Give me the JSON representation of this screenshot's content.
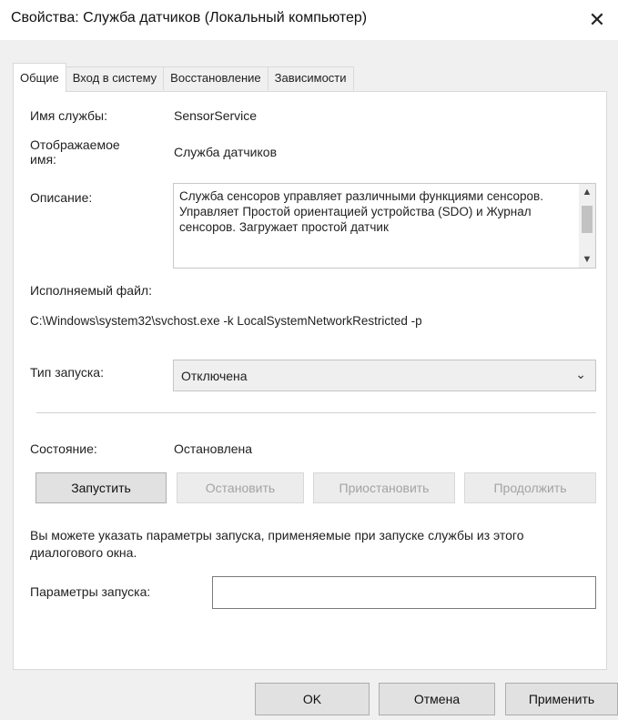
{
  "window": {
    "title": "Свойства: Служба датчиков (Локальный компьютер)",
    "close_glyph": "✕"
  },
  "tabs": [
    {
      "label": "Общие",
      "active": true
    },
    {
      "label": "Вход в систему",
      "active": false
    },
    {
      "label": "Восстановление",
      "active": false
    },
    {
      "label": "Зависимости",
      "active": false
    }
  ],
  "general": {
    "service_name_label": "Имя службы:",
    "service_name_value": "SensorService",
    "display_name_label_1": "Отображаемое",
    "display_name_label_2": "имя:",
    "display_name_value": "Служба датчиков",
    "description_label": "Описание:",
    "description_text": "Служба сенсоров управляет различными функциями сенсоров. Управляет Простой ориентацией устройства (SDO) и Журнал сенсоров. Загружает простой датчик",
    "executable_label": "Исполняемый файл:",
    "executable_path": "C:\\Windows\\system32\\svchost.exe -k LocalSystemNetworkRestricted -p",
    "startup_type_label": "Тип запуска:",
    "startup_type_value": "Отключена",
    "status_label": "Состояние:",
    "status_value": "Остановлена",
    "buttons": {
      "start": "Запустить",
      "stop": "Остановить",
      "pause": "Приостановить",
      "resume": "Продолжить"
    },
    "hint_text": "Вы можете указать параметры запуска, применяемые при запуске службы из этого диалогового окна.",
    "start_params_label": "Параметры запуска:",
    "start_params_value": ""
  },
  "footer": {
    "ok": "OK",
    "cancel": "Отмена",
    "apply": "Применить"
  },
  "icons": {
    "scroll_up": "▲",
    "scroll_down": "▼",
    "chevron_down": "⌄"
  }
}
